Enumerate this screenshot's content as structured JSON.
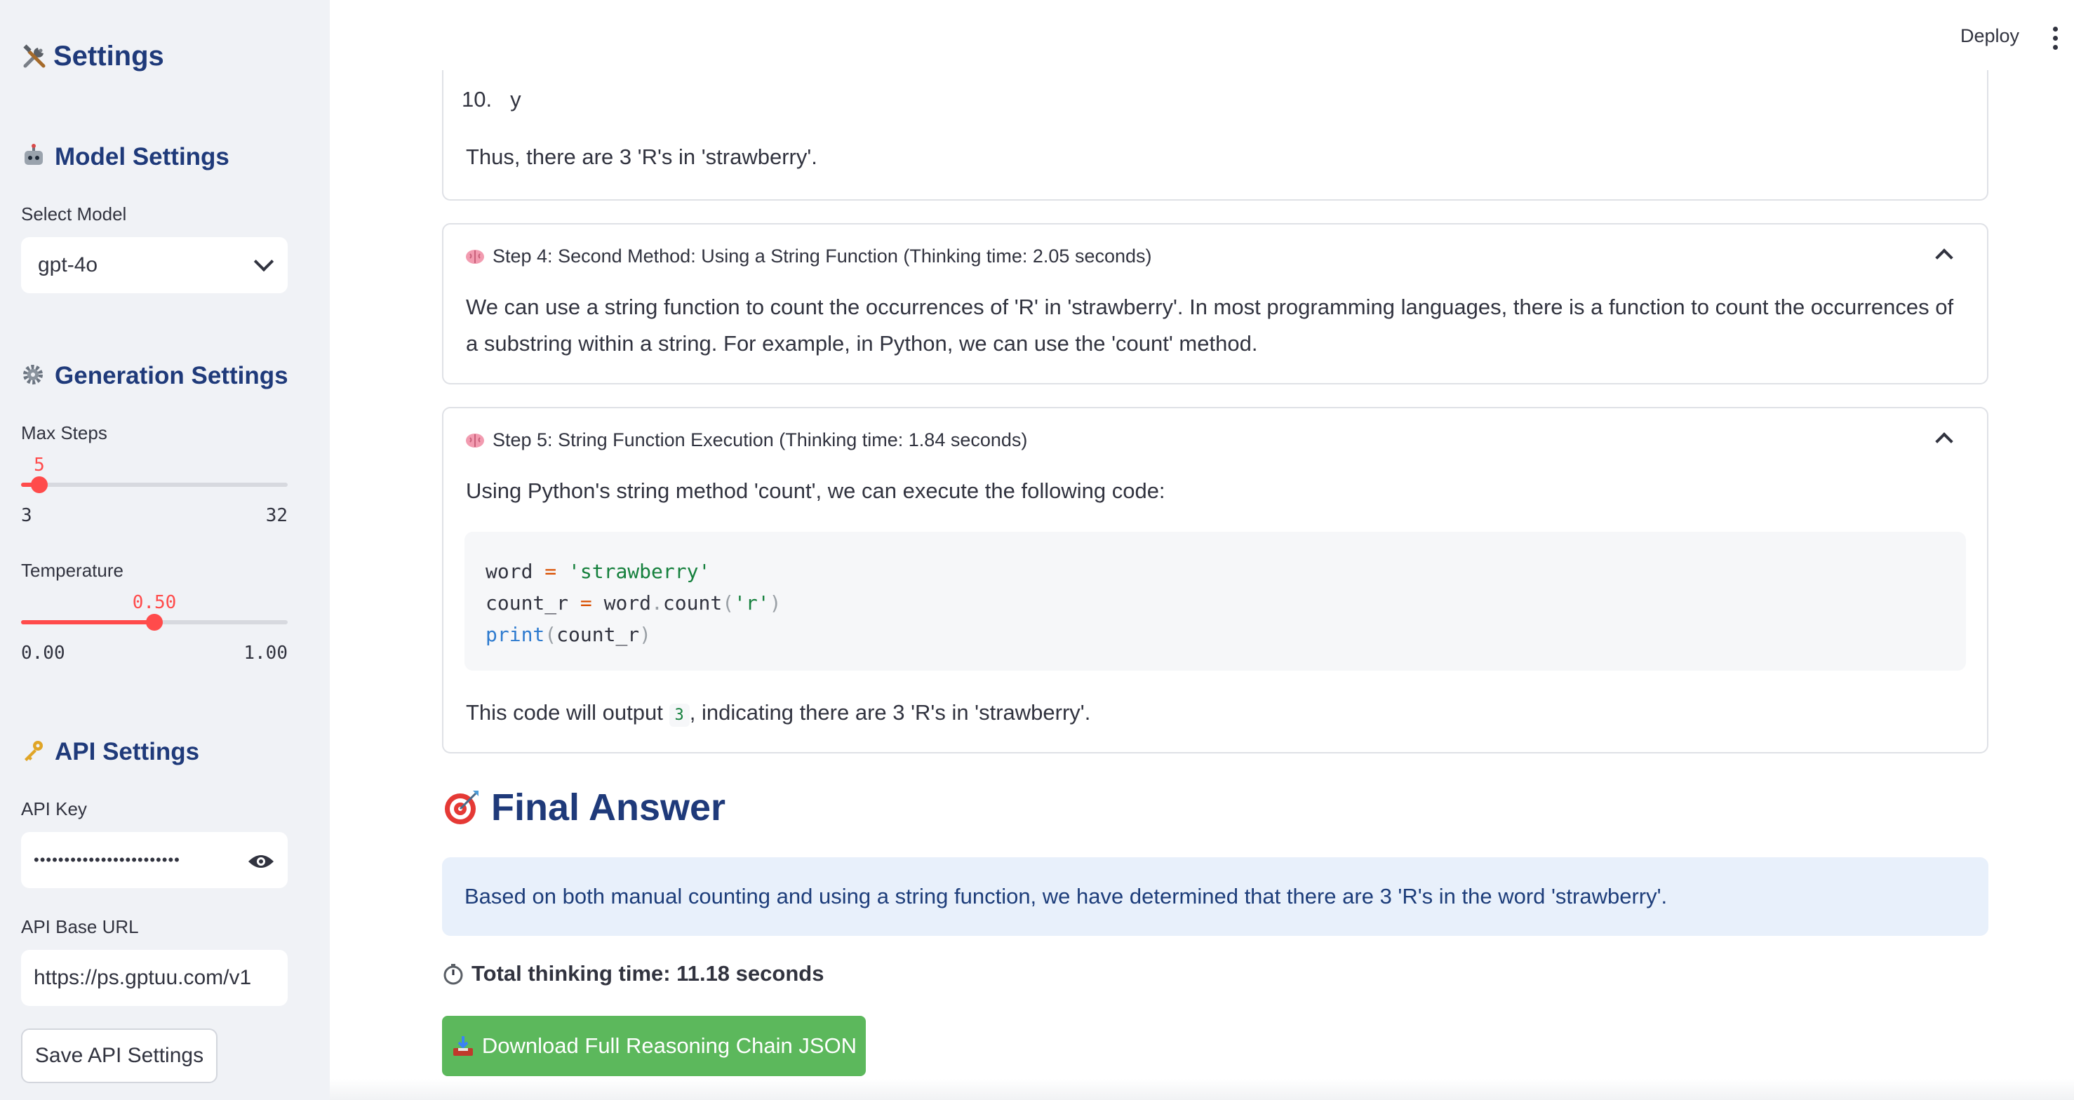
{
  "header": {
    "deploy_label": "Deploy"
  },
  "sidebar": {
    "title": "Settings",
    "model_section": {
      "heading": "Model Settings",
      "select_label": "Select Model",
      "selected_model": "gpt-4o"
    },
    "generation_section": {
      "heading": "Generation Settings",
      "max_steps": {
        "label": "Max Steps",
        "value": "5",
        "min": "3",
        "max": "32",
        "fraction": 0.07
      },
      "temperature": {
        "label": "Temperature",
        "value": "0.50",
        "min": "0.00",
        "max": "1.00",
        "fraction": 0.5
      }
    },
    "api_section": {
      "heading": "API Settings",
      "key_label": "API Key",
      "key_value": "••••••••••••••••••••••••",
      "base_url_label": "API Base URL",
      "base_url_value": "https://ps.gptuu.com/v1",
      "save_label": "Save API Settings"
    }
  },
  "main": {
    "step3_tail": {
      "list_number": "10.",
      "list_text": "y",
      "conclusion": "Thus, there are 3 'R's in 'strawberry'."
    },
    "step4": {
      "title": "Step 4: Second Method: Using a String Function (Thinking time: 2.05 seconds)",
      "body": "We can use a string function to count the occurrences of 'R' in 'strawberry'. In most programming languages, there is a function to count the occurrences of a substring within a string. For example, in Python, we can use the 'count' method."
    },
    "step5": {
      "title": "Step 5: String Function Execution (Thinking time: 1.84 seconds)",
      "intro": "Using Python's string method 'count', we can execute the following code:",
      "code": {
        "l1_var": "word",
        "l1_op": "=",
        "l1_str": "'strawberry'",
        "l2_var": "count_r",
        "l2_op": "=",
        "l2_obj": "word",
        "l2_dot": ".",
        "l2_fn": "count",
        "l2_open": "(",
        "l2_str": "'r'",
        "l2_close": ")",
        "l3_fn": "print",
        "l3_open": "(",
        "l3_arg": "count_r",
        "l3_close": ")"
      },
      "outro_before": "This code will output",
      "outro_code": "3",
      "outro_after": ", indicating there are 3 'R's in 'strawberry'."
    },
    "final_heading": "Final Answer",
    "final_answer": "Based on both manual counting and using a string function, we have determined that there are 3 'R's in the word 'strawberry'.",
    "total_time": "Total thinking time: 11.18 seconds",
    "download_label": "Download Full Reasoning Chain JSON"
  },
  "colors": {
    "accent": "#ff4b4b",
    "heading": "#1f3a7a",
    "download_bg": "#5cb85c",
    "answer_bg": "#e8f0fb"
  },
  "icons": [
    "tools-icon",
    "robot-icon",
    "gear-icon",
    "key-icon",
    "eye-icon",
    "brain-icon",
    "target-icon",
    "stopwatch-icon",
    "inbox-tray-icon",
    "chevron-down-icon",
    "chevron-up-icon",
    "kebab-menu-icon"
  ]
}
